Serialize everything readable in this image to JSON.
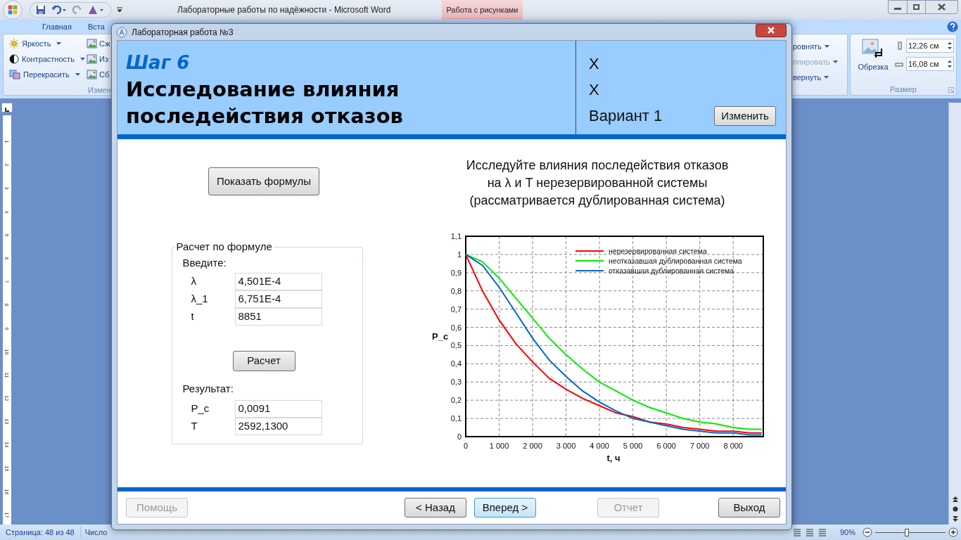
{
  "word": {
    "title_bar": {
      "title": "Лабораторные работы по надёжности - Microsoft Word",
      "contextual_tab": "Работа с рисунками"
    },
    "tabs": [
      {
        "label": "Главная"
      },
      {
        "label": "Вста"
      }
    ],
    "ribbon": {
      "adjust_items": [
        {
          "label": "Яркость"
        },
        {
          "label": "Контрастность"
        },
        {
          "label": "Перекрасить"
        }
      ],
      "picture_items": [
        {
          "label": "Сж"
        },
        {
          "label": "Из"
        },
        {
          "label": "Сб"
        }
      ],
      "adjust_group_label": "Измен",
      "arrange_items": [
        {
          "label": "ровнять",
          "disabled": false
        },
        {
          "label": "ппировать",
          "disabled": true
        },
        {
          "label": "вернуть",
          "disabled": false
        }
      ],
      "size_group": {
        "crop_label": "Обрезка",
        "height": "12,26 см",
        "width": "16,08 см",
        "label": "Размер"
      }
    },
    "ruler_marks": [
      "1",
      "2",
      "3",
      "4",
      "5",
      "6",
      "7",
      "8",
      "9",
      "10",
      "11",
      "12",
      "13",
      "14",
      "15",
      "16",
      "17"
    ],
    "status_bar": {
      "page": "Страница: 48 из 48",
      "words": "Число",
      "zoom": "90%",
      "zoom_slider": {
        "level": 0.45
      }
    }
  },
  "dialog": {
    "title": "Лабораторная работа №3",
    "header": {
      "step": "Шаг 6",
      "heading_lines": [
        "Исследование влияния",
        "последействия отказов"
      ],
      "info_lines": [
        "X",
        "X"
      ],
      "variant": "Вариант 1",
      "change_button": "Изменить"
    },
    "formulas_button": "Показать формулы",
    "calc": {
      "legend": "Расчет по формуле",
      "input_label": "Введите:",
      "inputs": [
        {
          "label": "λ",
          "value": "4,501E-4"
        },
        {
          "label": "λ_1",
          "value": "6,751E-4"
        },
        {
          "label": "t",
          "value": "8851"
        }
      ],
      "calc_button": "Расчет",
      "result_label": "Результат:",
      "results": [
        {
          "label": "P_c",
          "value": "0,0091"
        },
        {
          "label": "T",
          "value": "2592,1300"
        }
      ]
    },
    "chart_title_lines": [
      "Исследуйте влияния последействия отказов",
      "на λ и T нерезервированной системы",
      "(рассматривается дублированная система)"
    ],
    "chart": {
      "chart_data": {
        "type": "line",
        "xlabel": "t, ч",
        "ylabel": "P_c",
        "x": [
          0,
          500,
          1000,
          1500,
          2000,
          2500,
          3000,
          3500,
          4000,
          4500,
          5000,
          5500,
          6000,
          6500,
          7000,
          7500,
          8000,
          8500,
          8851
        ],
        "series": [
          {
            "name": "нерезервированная система",
            "color": "#ff0000",
            "values": [
              1,
              0.8,
              0.64,
              0.51,
              0.41,
              0.32,
              0.26,
              0.21,
              0.17,
              0.13,
              0.11,
              0.08,
              0.07,
              0.05,
              0.04,
              0.03,
              0.03,
              0.02,
              0.02
            ]
          },
          {
            "name": "неотказавшая дублированная система",
            "color": "#00ee00",
            "values": [
              1,
              0.96,
              0.87,
              0.76,
              0.65,
              0.54,
              0.45,
              0.37,
              0.3,
              0.25,
              0.2,
              0.16,
              0.13,
              0.1,
              0.08,
              0.07,
              0.05,
              0.04,
              0.04
            ]
          },
          {
            "name": "отказавшая дублированная система",
            "color": "#0066cc",
            "values": [
              1,
              0.94,
              0.82,
              0.68,
              0.54,
              0.42,
              0.33,
              0.25,
              0.19,
              0.14,
              0.1,
              0.08,
              0.06,
              0.04,
              0.03,
              0.02,
              0.02,
              0.01,
              0.01
            ]
          }
        ],
        "xlim": [
          0,
          8900
        ],
        "ylim": [
          0,
          1.1
        ],
        "grid": true,
        "legend": true,
        "xticks": [
          {
            "value": 0,
            "label": "0"
          },
          {
            "value": 1000,
            "label": "1 000"
          },
          {
            "value": 2000,
            "label": "2 000"
          },
          {
            "value": 3000,
            "label": "3 000"
          },
          {
            "value": 4000,
            "label": "4 000"
          },
          {
            "value": 5000,
            "label": "5 000"
          },
          {
            "value": 6000,
            "label": "6 000"
          },
          {
            "value": 7000,
            "label": "7 000"
          },
          {
            "value": 8000,
            "label": "8 000"
          }
        ],
        "yticks": [
          {
            "value": 0,
            "label": "0"
          },
          {
            "value": 0.1,
            "label": "0,1"
          },
          {
            "value": 0.2,
            "label": "0,2"
          },
          {
            "value": 0.3,
            "label": "0,3"
          },
          {
            "value": 0.4,
            "label": "0,4"
          },
          {
            "value": 0.5,
            "label": "0,5"
          },
          {
            "value": 0.6,
            "label": "0,6"
          },
          {
            "value": 0.7,
            "label": "0,7"
          },
          {
            "value": 0.8,
            "label": "0,8"
          },
          {
            "value": 0.9,
            "label": "0,9"
          },
          {
            "value": 1,
            "label": "1"
          },
          {
            "value": 1.1,
            "label": "1,1"
          }
        ]
      }
    },
    "footer": {
      "buttons": [
        {
          "label": "Помощь",
          "disabled": true,
          "focused": false
        },
        {
          "label": "< Назад",
          "disabled": false,
          "focused": false
        },
        {
          "label": "Вперед >",
          "disabled": false,
          "focused": true
        },
        {
          "label": "Отчет",
          "disabled": true,
          "focused": false
        },
        {
          "label": "Выход",
          "disabled": false,
          "focused": false
        }
      ]
    }
  }
}
